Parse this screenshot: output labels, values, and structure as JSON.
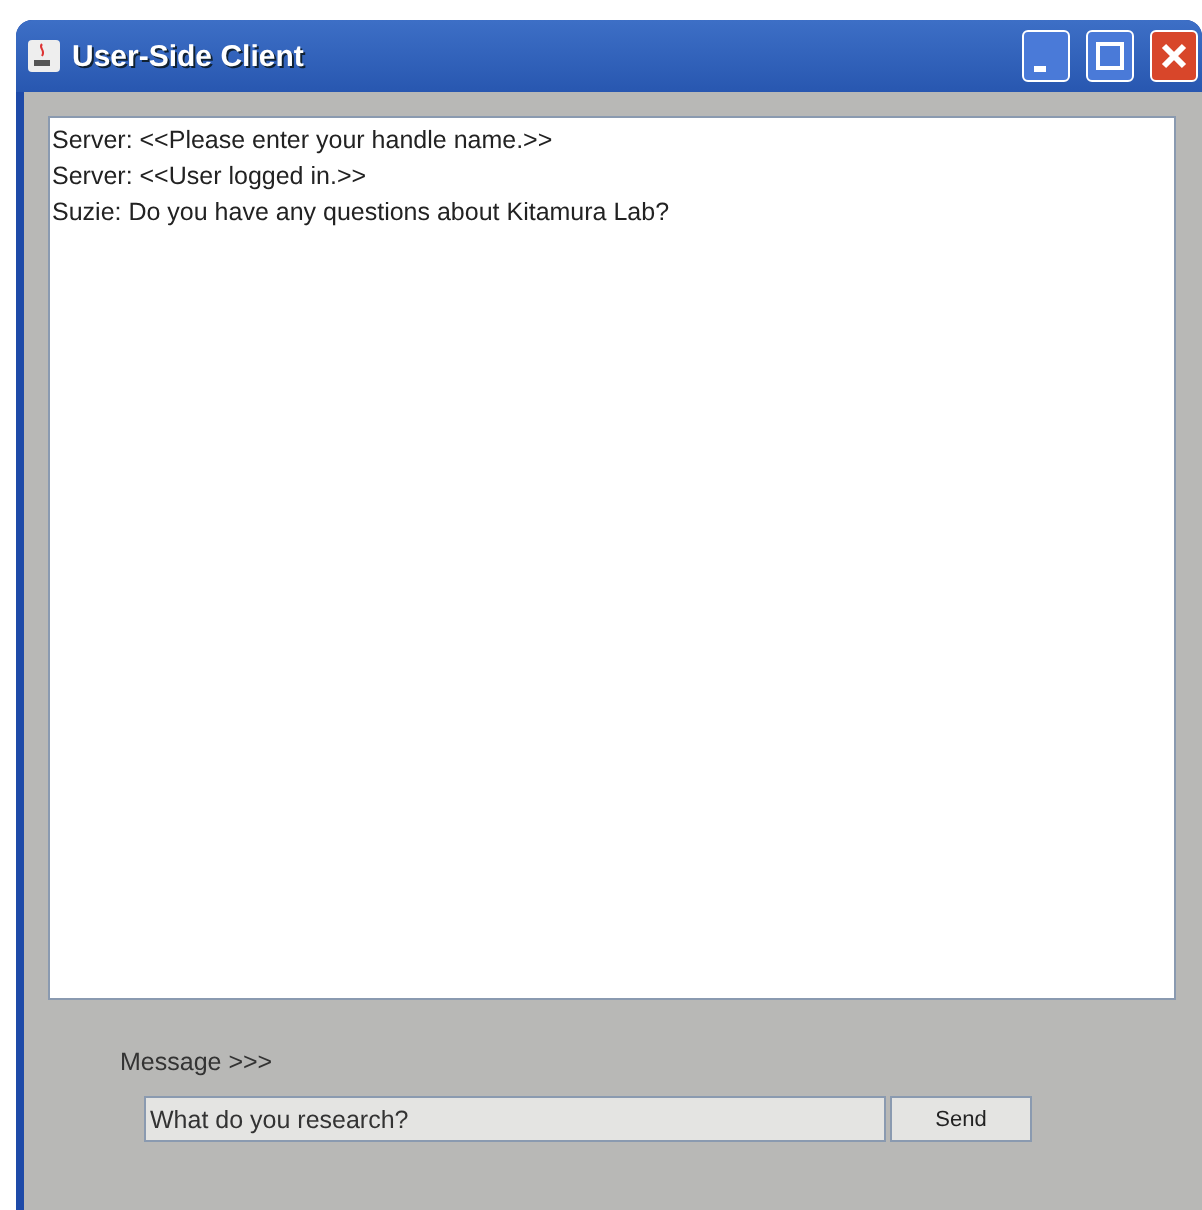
{
  "window": {
    "title": "User-Side Client"
  },
  "log": [
    "Server: <<Please enter your handle name.>>",
    "Server: <<User logged in.>>",
    "Suzie: Do you have any questions about Kitamura Lab?"
  ],
  "message": {
    "label": "Message >>>",
    "value": "What do you research?"
  },
  "buttons": [
    "Send"
  ]
}
